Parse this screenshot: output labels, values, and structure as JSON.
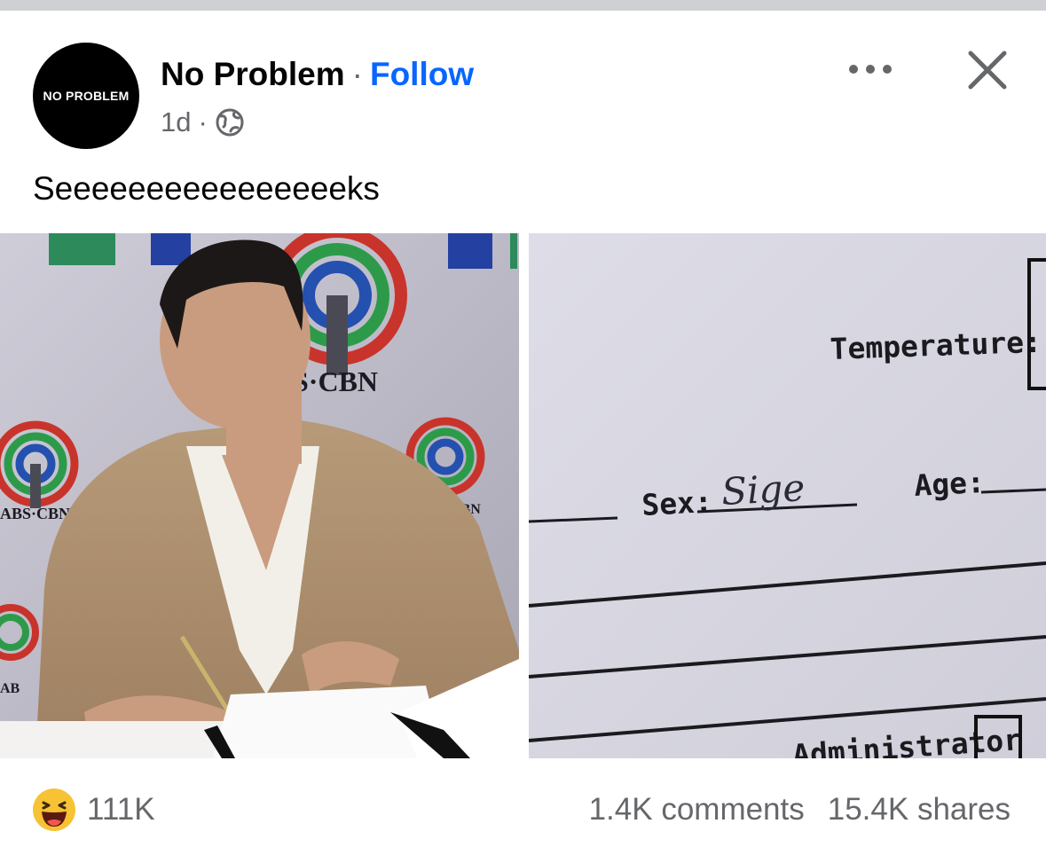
{
  "post": {
    "page_name": "No Problem",
    "separator": "·",
    "follow_label": "Follow",
    "avatar_text": "NO PROBLEM",
    "time": "1d",
    "meta_separator": "·",
    "audience_icon": "globe-icon",
    "menu_icon": "more-horizontal-icon",
    "close_icon": "close-icon",
    "text": "Seeeeeeeeeeeeeeeeks"
  },
  "photos": {
    "left": {
      "backdrop_text_1": "S·CBN",
      "backdrop_text_2": "ABS·CBN",
      "backdrop_text_3": "CBN",
      "backdrop_text_4": "AB"
    },
    "right": {
      "temperature_label": "Temperature:",
      "sex_label": "Sex:",
      "sex_value": "Sige",
      "age_label": "Age:",
      "admin_label": "Administrator"
    }
  },
  "footer": {
    "reaction_icon": "haha-emoji-icon",
    "reaction_count": "111K",
    "comments": "1.4K comments",
    "shares": "15.4K shares"
  },
  "colors": {
    "accent": "#0866ff",
    "secondary_text": "#65676b",
    "divider": "#ced0d4"
  }
}
